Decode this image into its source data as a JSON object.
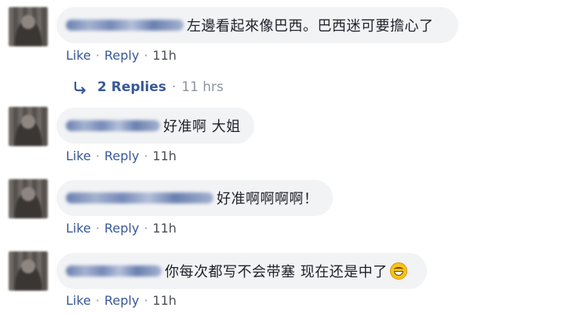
{
  "colors": {
    "link": "#385898",
    "meta": "#90949c",
    "bubble": "#f2f3f5",
    "text": "#1d2129"
  },
  "actions": {
    "like": "Like",
    "reply": "Reply",
    "separator": "·"
  },
  "comments": [
    {
      "text": "左邊看起來像巴西。巴西迷可要擔心了",
      "time": "11h"
    },
    {
      "text": "好准啊 大姐",
      "time": "11h"
    },
    {
      "text": "好准啊啊啊啊！",
      "time": "11h"
    },
    {
      "text": "你每次都写不会带塞 现在还是中了",
      "emoji": "grinning-sweat-emoji",
      "time": "11h"
    }
  ],
  "replies": {
    "icon": "reply-arrow-icon",
    "label": "2 Replies",
    "separator": "·",
    "time": "11 hrs"
  }
}
